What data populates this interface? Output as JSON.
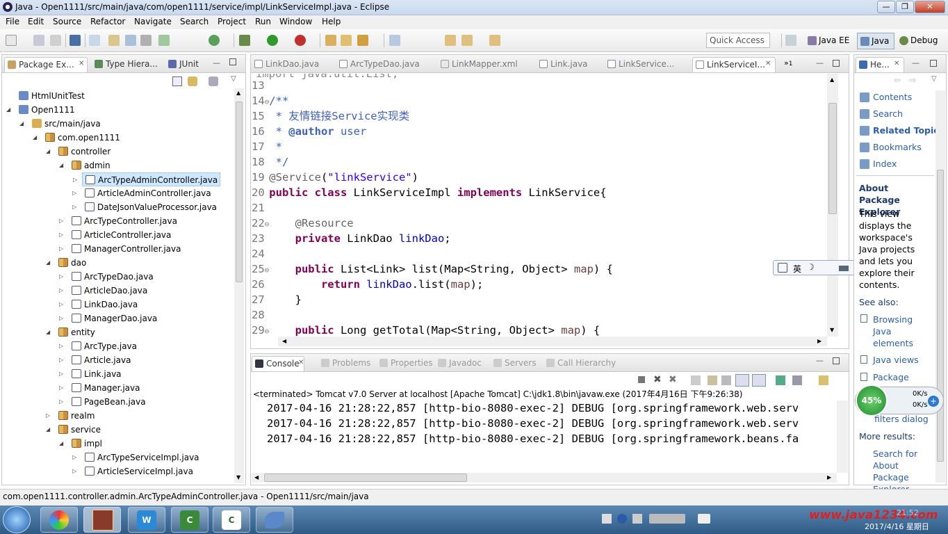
{
  "window": {
    "title": "Java - Open1111/src/main/java/com/open1111/service/impl/LinkServiceImpl.java - Eclipse"
  },
  "menu": [
    "File",
    "Edit",
    "Source",
    "Refactor",
    "Navigate",
    "Search",
    "Project",
    "Run",
    "Window",
    "Help"
  ],
  "toolbar": {
    "quick_access": "Quick Access",
    "perspectives": [
      "Java EE",
      "Java",
      "Debug"
    ]
  },
  "left_panel": {
    "tabs": [
      "Package Ex...",
      "Type Hiera...",
      "JUnit"
    ],
    "tree": [
      {
        "label": "HtmlUnitTest",
        "depth": 0,
        "icon": "project"
      },
      {
        "label": "Open1111",
        "depth": 0,
        "icon": "project",
        "expanded": true
      },
      {
        "label": "src/main/java",
        "depth": 1,
        "icon": "source-folder",
        "expanded": true
      },
      {
        "label": "com.open1111",
        "depth": 2,
        "icon": "package",
        "expanded": true
      },
      {
        "label": "controller",
        "depth": 3,
        "icon": "package",
        "expanded": true
      },
      {
        "label": "admin",
        "depth": 4,
        "icon": "package",
        "expanded": true
      },
      {
        "label": "ArcTypeAdminController.java",
        "depth": 5,
        "icon": "java",
        "selected": true
      },
      {
        "label": "ArticleAdminController.java",
        "depth": 5,
        "icon": "java"
      },
      {
        "label": "DateJsonValueProcessor.java",
        "depth": 5,
        "icon": "java"
      },
      {
        "label": "ArcTypeController.java",
        "depth": 4,
        "icon": "java"
      },
      {
        "label": "ArticleController.java",
        "depth": 4,
        "icon": "java"
      },
      {
        "label": "ManagerController.java",
        "depth": 4,
        "icon": "java"
      },
      {
        "label": "dao",
        "depth": 3,
        "icon": "package",
        "expanded": true
      },
      {
        "label": "ArcTypeDao.java",
        "depth": 4,
        "icon": "java"
      },
      {
        "label": "ArticleDao.java",
        "depth": 4,
        "icon": "java"
      },
      {
        "label": "LinkDao.java",
        "depth": 4,
        "icon": "java"
      },
      {
        "label": "ManagerDao.java",
        "depth": 4,
        "icon": "java"
      },
      {
        "label": "entity",
        "depth": 3,
        "icon": "package",
        "expanded": true
      },
      {
        "label": "ArcType.java",
        "depth": 4,
        "icon": "java"
      },
      {
        "label": "Article.java",
        "depth": 4,
        "icon": "java"
      },
      {
        "label": "Link.java",
        "depth": 4,
        "icon": "java"
      },
      {
        "label": "Manager.java",
        "depth": 4,
        "icon": "java"
      },
      {
        "label": "PageBean.java",
        "depth": 4,
        "icon": "java"
      },
      {
        "label": "realm",
        "depth": 3,
        "icon": "package"
      },
      {
        "label": "service",
        "depth": 3,
        "icon": "package",
        "expanded": true
      },
      {
        "label": "impl",
        "depth": 4,
        "icon": "package",
        "expanded": true
      },
      {
        "label": "ArcTypeServiceImpl.java",
        "depth": 5,
        "icon": "java"
      },
      {
        "label": "ArticleServiceImpl.java",
        "depth": 5,
        "icon": "java"
      }
    ]
  },
  "editor": {
    "tabs": [
      "LinkDao.java",
      "ArcTypeDao.java",
      "LinkMapper.xml",
      "Link.java",
      "LinkService...",
      "LinkServiceI..."
    ],
    "overflow_count": "1",
    "lines": [
      {
        "n": "13",
        "parts": []
      },
      {
        "n": "14",
        "fold": "⊖",
        "parts": [
          {
            "c": "cm",
            "t": "/**"
          }
        ]
      },
      {
        "n": "15",
        "parts": [
          {
            "c": "cm",
            "t": " * 友情链接Service实现类"
          }
        ]
      },
      {
        "n": "16",
        "parts": [
          {
            "c": "cm",
            "t": " * "
          },
          {
            "c": "cm b",
            "t": "@author"
          },
          {
            "c": "cm",
            "t": " user"
          }
        ]
      },
      {
        "n": "17",
        "parts": [
          {
            "c": "cm",
            "t": " *"
          }
        ]
      },
      {
        "n": "18",
        "parts": [
          {
            "c": "cm",
            "t": " */"
          }
        ]
      },
      {
        "n": "19",
        "parts": [
          {
            "c": "an",
            "t": "@Service"
          },
          {
            "c": "",
            "t": "("
          },
          {
            "c": "st",
            "t": "\"linkService\""
          },
          {
            "c": "",
            "t": ")"
          }
        ]
      },
      {
        "n": "20",
        "parts": [
          {
            "c": "kw",
            "t": "public class"
          },
          {
            "c": "",
            "t": " LinkServiceImpl "
          },
          {
            "c": "kw",
            "t": "implements"
          },
          {
            "c": "",
            "t": " LinkService{"
          }
        ]
      },
      {
        "n": "21",
        "parts": []
      },
      {
        "n": "22",
        "fold": "⊖",
        "parts": [
          {
            "c": "an",
            "t": "    @Resource"
          }
        ]
      },
      {
        "n": "23",
        "parts": [
          {
            "c": "kw",
            "t": "    private"
          },
          {
            "c": "",
            "t": " LinkDao "
          },
          {
            "c": "fd",
            "t": "linkDao"
          },
          {
            "c": "",
            "t": ";"
          }
        ]
      },
      {
        "n": "24",
        "parts": []
      },
      {
        "n": "25",
        "fold": "⊖",
        "parts": [
          {
            "c": "kw",
            "t": "    public"
          },
          {
            "c": "",
            "t": " List<Link> list(Map<String, Object> "
          },
          {
            "c": "pm",
            "t": "map"
          },
          {
            "c": "",
            "t": ") {"
          }
        ]
      },
      {
        "n": "26",
        "parts": [
          {
            "c": "kw",
            "t": "        return"
          },
          {
            "c": "",
            "t": " "
          },
          {
            "c": "fd",
            "t": "linkDao"
          },
          {
            "c": "",
            "t": ".list("
          },
          {
            "c": "pm",
            "t": "map"
          },
          {
            "c": "",
            "t": ");"
          }
        ]
      },
      {
        "n": "27",
        "parts": [
          {
            "c": "",
            "t": "    }"
          }
        ]
      },
      {
        "n": "28",
        "parts": []
      },
      {
        "n": "29",
        "fold": "⊖",
        "parts": [
          {
            "c": "kw",
            "t": "    public"
          },
          {
            "c": "",
            "t": " Long getTotal(Map<String, Object> "
          },
          {
            "c": "pm",
            "t": "map"
          },
          {
            "c": "",
            "t": ") {"
          }
        ]
      }
    ]
  },
  "console": {
    "tabs": [
      "Console",
      "Problems",
      "Properties",
      "Javadoc",
      "Servers",
      "Call Hierarchy"
    ],
    "header": "<terminated> Tomcat v7.0 Server at localhost [Apache Tomcat] C:\\jdk1.8\\bin\\javaw.exe (2017年4月16日 下午9:26:38)",
    "lines": [
      "2017-04-16 21:28:22,857 [http-bio-8080-exec-2] DEBUG [org.springframework.web.serv",
      "2017-04-16 21:28:22,857 [http-bio-8080-exec-2] DEBUG [org.springframework.web.serv",
      "2017-04-16 21:28:22,857 [http-bio-8080-exec-2] DEBUG [org.springframework.beans.fa"
    ]
  },
  "help": {
    "tab": "He...",
    "nav": [
      "Contents",
      "Search",
      "Related Topics",
      "Bookmarks",
      "Index"
    ],
    "about_title": "About Package Explorer",
    "about_lines": [
      "This view",
      "displays the",
      "workspace's",
      "Java projects",
      "and lets you",
      "explore their",
      "contents."
    ],
    "see_also": "See also:",
    "links": [
      "Browsing Java elements",
      "Java views",
      "Package",
      "filters dialog"
    ],
    "more": "More results:",
    "search_link": "Search for About Package Explorer"
  },
  "ime": {
    "label": "英"
  },
  "net_widget": {
    "percent": "45%",
    "up": "0K/s",
    "down": "0K/s"
  },
  "status": {
    "text": "com.open1111.controller.admin.ArcTypeAdminController.java - Open1111/src/main/java"
  },
  "taskbar": {
    "watermark": "www.java1234.com",
    "date": "2017/4/16 星期日",
    "time": "21:52"
  }
}
